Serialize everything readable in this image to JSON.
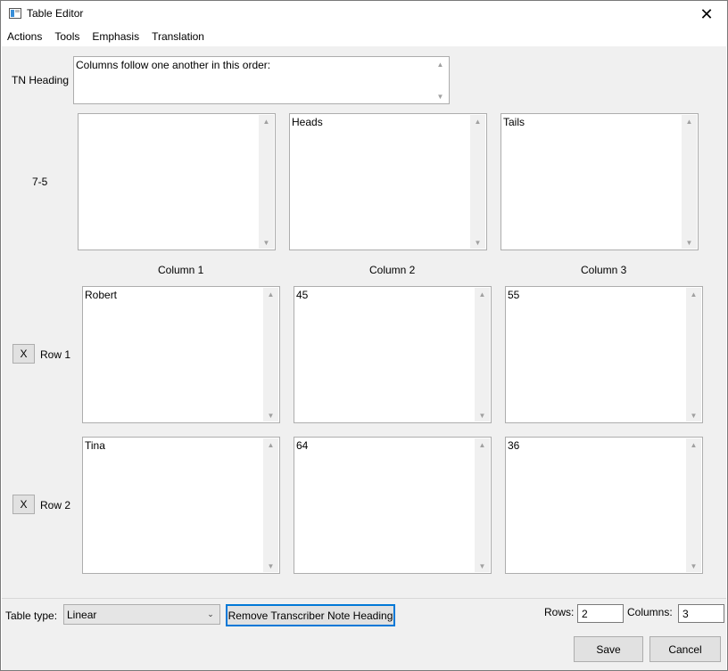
{
  "window": {
    "title": "Table Editor"
  },
  "menu": [
    "Actions",
    "Tools",
    "Emphasis",
    "Translation"
  ],
  "tn_heading": {
    "label": "TN Heading",
    "value": "Columns follow one another in this order:"
  },
  "header_row": {
    "label": "7-5",
    "cells": [
      "",
      "Heads",
      "Tails"
    ]
  },
  "columns": [
    "Column 1",
    "Column 2",
    "Column 3"
  ],
  "rows": [
    {
      "delete_label": "X",
      "label": "Row 1",
      "cells": [
        "Robert",
        "45",
        "55"
      ]
    },
    {
      "delete_label": "X",
      "label": "Row 2",
      "cells": [
        "Tina",
        "64",
        "36"
      ]
    }
  ],
  "footer": {
    "table_type_label": "Table type:",
    "table_type_value": "Linear",
    "remove_tn_button": "Remove Transcriber Note Heading",
    "rows_label": "Rows:",
    "rows_value": "2",
    "columns_label": "Columns:",
    "columns_value": "3",
    "save_button": "Save",
    "cancel_button": "Cancel"
  }
}
